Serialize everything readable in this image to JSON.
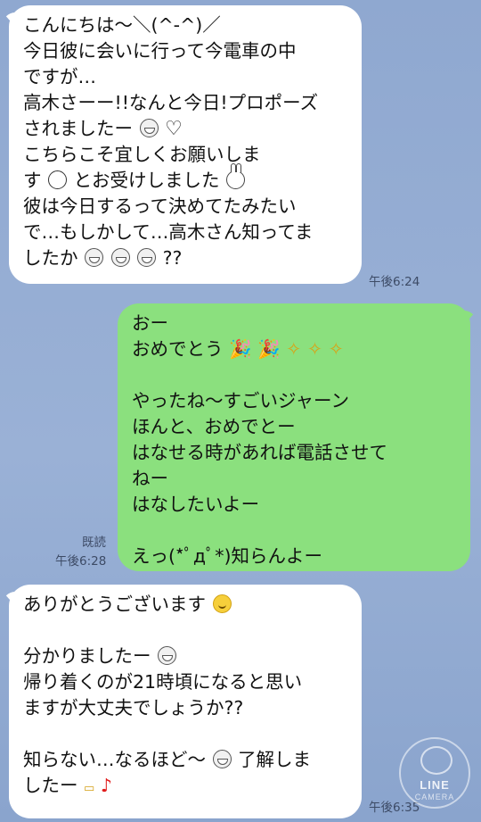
{
  "messages": [
    {
      "side": "received",
      "time": "午後6:24",
      "lines": [
        "こんにちは〜＼(^-^)／",
        "今日彼に会いに行って今電車の中",
        "ですが…",
        "高木さーー!!なんと今日!プロポーズ",
        "されましたー",
        "こちらこそ宜しくお願いしま",
        "す",
        "とお受けしました",
        "彼は今日するって決めてたみたい",
        "で…もしかして…高木さん知ってま",
        "したか",
        "??"
      ]
    },
    {
      "side": "sent",
      "read": "既読",
      "time": "午後6:28",
      "lines": [
        "おー",
        "おめでとう",
        "やったね〜すごいジャーン",
        "ほんと、おめでとー",
        "はなせる時があれば電話させて",
        "ねー",
        "はなしたいよー",
        "えっ(*ﾟдﾟ*)知らんよー"
      ]
    },
    {
      "side": "received",
      "time": "午後6:35",
      "lines": [
        "ありがとうございます",
        "分かりましたー",
        "帰り着くのが21時頃になると思い",
        "ますが大丈夫でしょうか??",
        "知らない…なるほど〜",
        "了解しま",
        "したー"
      ]
    }
  ],
  "watermark": {
    "brand": "LINE",
    "sub": "CAMERA"
  },
  "icons": {
    "heart": "♡",
    "sparkle": "✧",
    "party": "🎉",
    "note": "♪"
  },
  "colors": {
    "sent_bubble": "#8be07e",
    "received_bubble": "#ffffff",
    "background": "#8ea7cf"
  }
}
